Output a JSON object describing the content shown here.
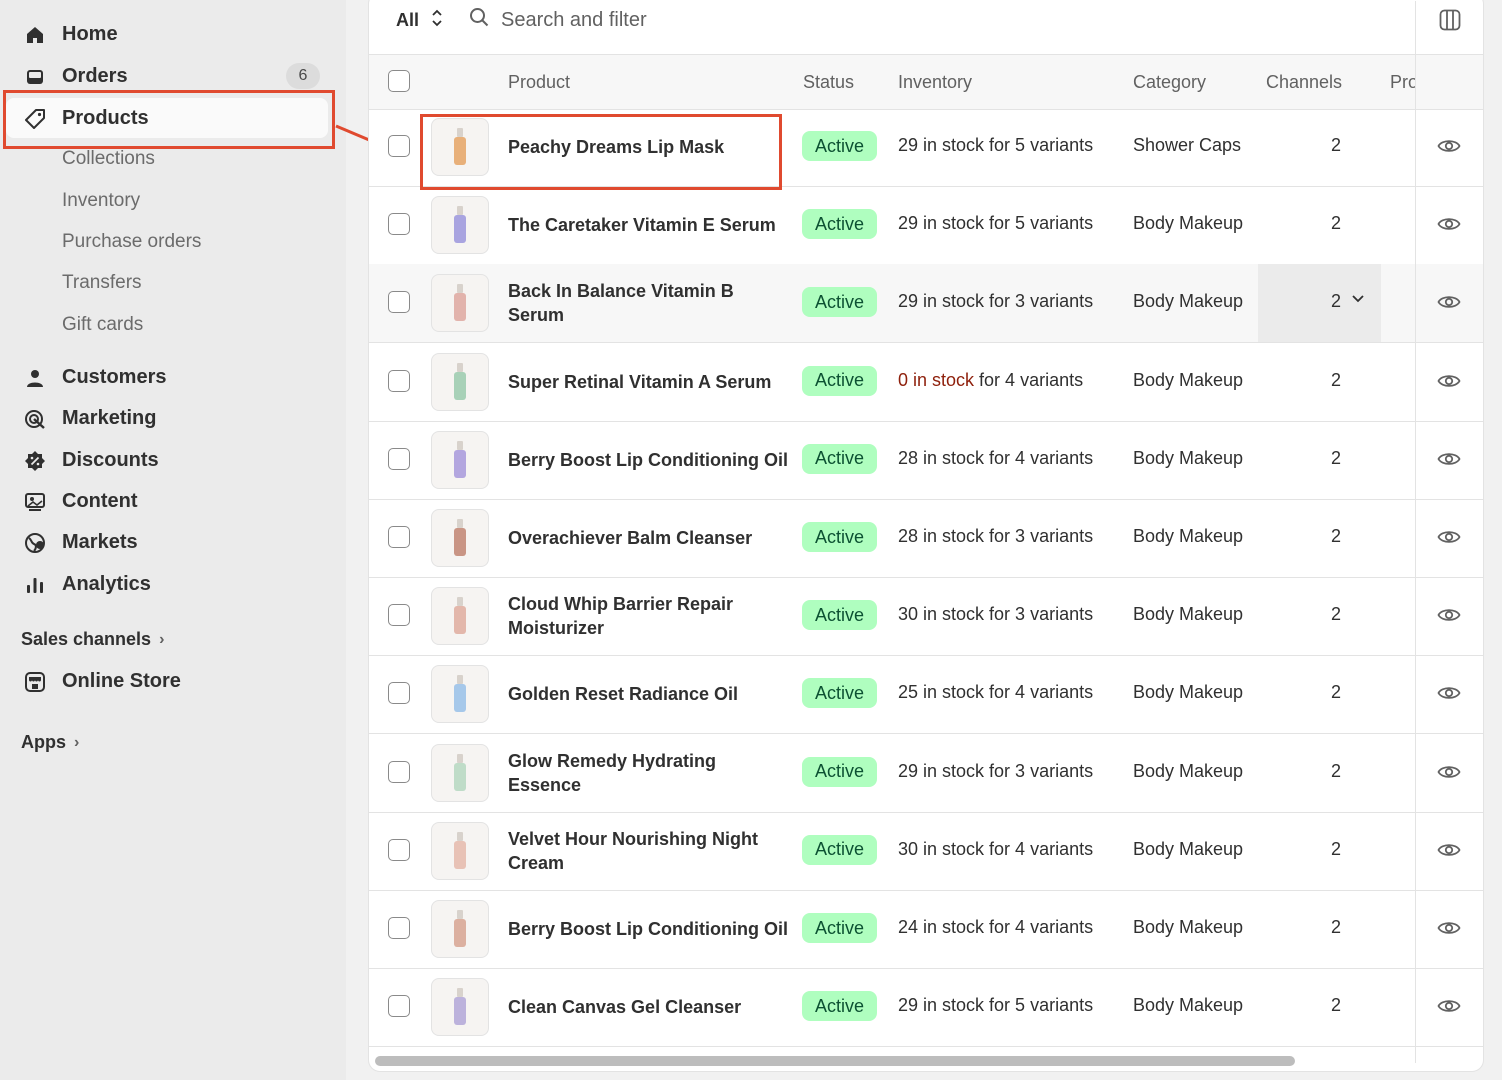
{
  "sidebar": {
    "items": [
      {
        "label": "Home",
        "icon": "home-icon"
      },
      {
        "label": "Orders",
        "icon": "orders-icon",
        "badge": "6"
      },
      {
        "label": "Products",
        "icon": "tag-icon",
        "active": true
      }
    ],
    "product_sub": [
      "Collections",
      "Inventory",
      "Purchase orders",
      "Transfers",
      "Gift cards"
    ],
    "items2": [
      {
        "label": "Customers",
        "icon": "person-icon"
      },
      {
        "label": "Marketing",
        "icon": "target-icon"
      },
      {
        "label": "Discounts",
        "icon": "discount-icon"
      },
      {
        "label": "Content",
        "icon": "content-icon"
      },
      {
        "label": "Markets",
        "icon": "globe-icon"
      },
      {
        "label": "Analytics",
        "icon": "bar-chart-icon"
      }
    ],
    "sales_channels": "Sales channels",
    "online_store": "Online Store",
    "apps": "Apps"
  },
  "toolbar": {
    "tab": "All",
    "search_placeholder": "Search and filter"
  },
  "table": {
    "headers": {
      "product": "Product",
      "status": "Status",
      "inventory": "Inventory",
      "category": "Category",
      "channels": "Channels",
      "more": "Pro"
    },
    "rows": [
      {
        "name": "Peachy Dreams Lip Mask",
        "status": "Active",
        "stock": "29 in stock",
        "variants": " for 5 variants",
        "category": "Shower Caps",
        "channels": "2",
        "color": "#e8b07a"
      },
      {
        "name": "The Caretaker Vitamin E Serum",
        "status": "Active",
        "stock": "29 in stock",
        "variants": " for 5 variants",
        "category": "Body Makeup",
        "channels": "2",
        "color": "#a9a4e0"
      },
      {
        "name": "Back In Balance Vitamin B Serum",
        "status": "Active",
        "stock": "29 in stock",
        "variants": " for 3 variants",
        "category": "Body Makeup",
        "channels": "2",
        "color": "#e2b3ac"
      },
      {
        "name": "Super Retinal Vitamin A Serum",
        "status": "Active",
        "stock": "0 in stock",
        "variants": " for 4 variants",
        "category": "Body Makeup",
        "channels": "2",
        "color": "#a8d1b8"
      },
      {
        "name": "Berry Boost Lip Conditioning Oil",
        "status": "Active",
        "stock": "28 in stock",
        "variants": " for 4 variants",
        "category": "Body Makeup",
        "channels": "2",
        "color": "#b3a6df"
      },
      {
        "name": "Overachiever Balm Cleanser",
        "status": "Active",
        "stock": "28 in stock",
        "variants": " for 3 variants",
        "category": "Body Makeup",
        "channels": "2",
        "color": "#c99585"
      },
      {
        "name": "Cloud Whip Barrier Repair Moisturizer",
        "status": "Active",
        "stock": "30 in stock",
        "variants": " for 3 variants",
        "category": "Body Makeup",
        "channels": "2",
        "color": "#e3b7ab"
      },
      {
        "name": "Golden Reset Radiance Oil",
        "status": "Active",
        "stock": "25 in stock",
        "variants": " for 4 variants",
        "category": "Body Makeup",
        "channels": "2",
        "color": "#a6c8ea"
      },
      {
        "name": "Glow Remedy Hydrating Essence",
        "status": "Active",
        "stock": "29 in stock",
        "variants": " for 3 variants",
        "category": "Body Makeup",
        "channels": "2",
        "color": "#bfdcc8"
      },
      {
        "name": "Velvet Hour Nourishing Night Cream",
        "status": "Active",
        "stock": "30 in stock",
        "variants": " for 4 variants",
        "category": "Body Makeup",
        "channels": "2",
        "color": "#e8c2b6"
      },
      {
        "name": "Berry Boost Lip Conditioning Oil",
        "status": "Active",
        "stock": "24 in stock",
        "variants": " for 4 variants",
        "category": "Body Makeup",
        "channels": "2",
        "color": "#dcb0a0"
      },
      {
        "name": "Clean Canvas Gel Cleanser",
        "status": "Active",
        "stock": "29 in stock",
        "variants": " for 5 variants",
        "category": "Body Makeup",
        "channels": "2",
        "color": "#bcb2dc"
      }
    ]
  }
}
